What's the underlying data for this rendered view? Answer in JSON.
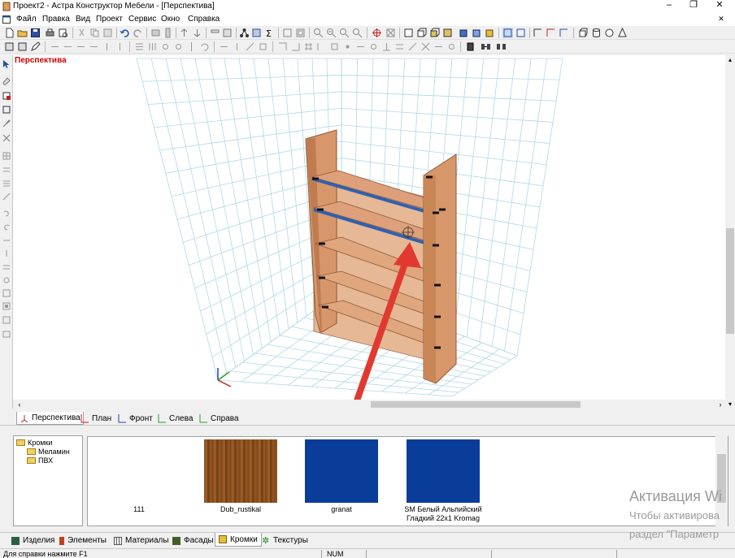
{
  "window": {
    "title": "Проект2 - Астра Конструктор Мебели - [Перспектива]"
  },
  "menu": [
    "Файл",
    "Правка",
    "Вид",
    "Проект",
    "Сервис",
    "Окно",
    "Справка"
  ],
  "viewport": {
    "label": "Перспектива"
  },
  "view_tabs": [
    "Перспектива",
    "План",
    "Фронт",
    "Слева",
    "Справа"
  ],
  "tree": {
    "root": "Кромки",
    "children": [
      "Меламин",
      "ПВХ"
    ]
  },
  "swatches": [
    {
      "name": "111",
      "color": "#ffffff"
    },
    {
      "name": "Dub_rustikal",
      "color": "#8a4f1c"
    },
    {
      "name": "granat",
      "color": "#0a3c99"
    },
    {
      "name": "SM Белый Альпийский Гладкий 22x1 Kromag",
      "color": "#0a3c99"
    }
  ],
  "bottom_tabs": [
    "Изделия",
    "Элементы",
    "Материалы",
    "Фасады",
    "Кромки",
    "Текстуры"
  ],
  "active_bottom_tab": "Кромки",
  "status": {
    "hint": "Для справки нажмите F1",
    "num": "NUM"
  },
  "watermark": {
    "line1": "Активация Wi",
    "line2": "Чтобы активирова",
    "line3": "раздел \"Параметр"
  },
  "colors": {
    "wood": "#d99a6c",
    "edge_blue": "#3060b0",
    "arrow": "#e03a30",
    "grid": "#b0d8e8"
  }
}
